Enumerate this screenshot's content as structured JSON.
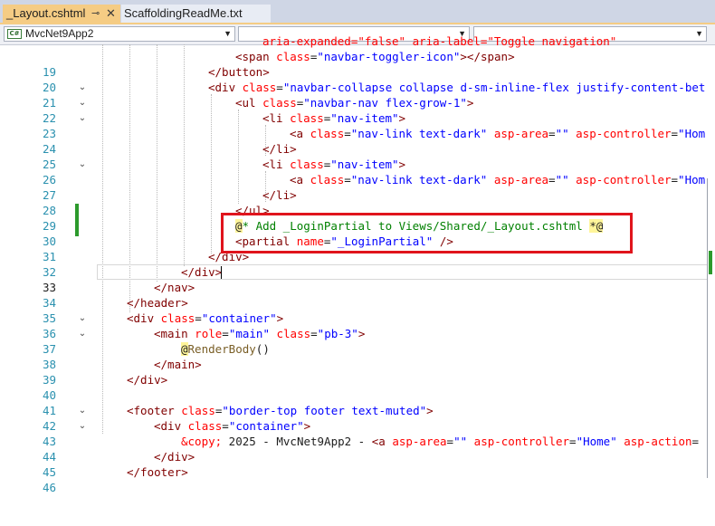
{
  "tabs": [
    {
      "label": "_Layout.cshtml",
      "pin_glyph": "⊸",
      "close_glyph": "✕",
      "active": true
    },
    {
      "label": "ScaffoldingReadMe.txt",
      "active": false
    }
  ],
  "navbar": {
    "project": "MvcNet9App2",
    "project_icon": "C#",
    "scope": "",
    "member": ""
  },
  "colors": {
    "active_tab": "#f5cc84",
    "line_number": "#2b91af",
    "tag": "#800000",
    "attribute": "#ff0000",
    "attribute_value": "#0000ff",
    "comment": "#008000",
    "razor_marker": "#fff59a",
    "highlight_box": "#e0141c",
    "change_bar": "#2c9a2c"
  },
  "code": {
    "line18_tail": "aria-expanded=\"false\" aria-label=\"Toggle navigation\"",
    "lines": [
      {
        "n": "19",
        "text": "<span class=\"navbar-toggler-icon\"></span>"
      },
      {
        "n": "20",
        "text": "</button>"
      },
      {
        "n": "21",
        "text": "<div class=\"navbar-collapse collapse d-sm-inline-flex justify-content-bet"
      },
      {
        "n": "22",
        "text": "<ul class=\"navbar-nav flex-grow-1\">"
      },
      {
        "n": "23",
        "text": "<li class=\"nav-item\">"
      },
      {
        "n": "24",
        "text": "<a class=\"nav-link text-dark\" asp-area=\"\" asp-controller=\"Hom"
      },
      {
        "n": "25",
        "text": "</li>"
      },
      {
        "n": "26",
        "text": "<li class=\"nav-item\">"
      },
      {
        "n": "27",
        "text": "<a class=\"nav-link text-dark\" asp-area=\"\" asp-controller=\"Hom"
      },
      {
        "n": "28",
        "text": "</li>"
      },
      {
        "n": "29",
        "text": "</ul>"
      },
      {
        "n": "30",
        "text": "@* Add _LoginPartial to Views/Shared/_Layout.cshtml *@"
      },
      {
        "n": "31",
        "text": "<partial name=\"_LoginPartial\" />"
      },
      {
        "n": "32",
        "text": "</div>"
      },
      {
        "n": "33",
        "text": "</div>"
      },
      {
        "n": "34",
        "text": "</nav>"
      },
      {
        "n": "35",
        "text": "</header>"
      },
      {
        "n": "36",
        "text": "<div class=\"container\">"
      },
      {
        "n": "37",
        "text": "<main role=\"main\" class=\"pb-3\">"
      },
      {
        "n": "38",
        "text": "@RenderBody()"
      },
      {
        "n": "39",
        "text": "</main>"
      },
      {
        "n": "40",
        "text": "</div>"
      },
      {
        "n": "41",
        "text": ""
      },
      {
        "n": "42",
        "text": "<footer class=\"border-top footer text-muted\">"
      },
      {
        "n": "43",
        "text": "<div class=\"container\">"
      },
      {
        "n": "44",
        "text": "&copy; 2025 - MvcNet9App2 - <a asp-area=\"\" asp-controller=\"Home\" asp-action="
      },
      {
        "n": "45",
        "text": "</div>"
      },
      {
        "n": "46",
        "text": "</footer>"
      }
    ]
  },
  "editor": {
    "current_line": "33"
  }
}
